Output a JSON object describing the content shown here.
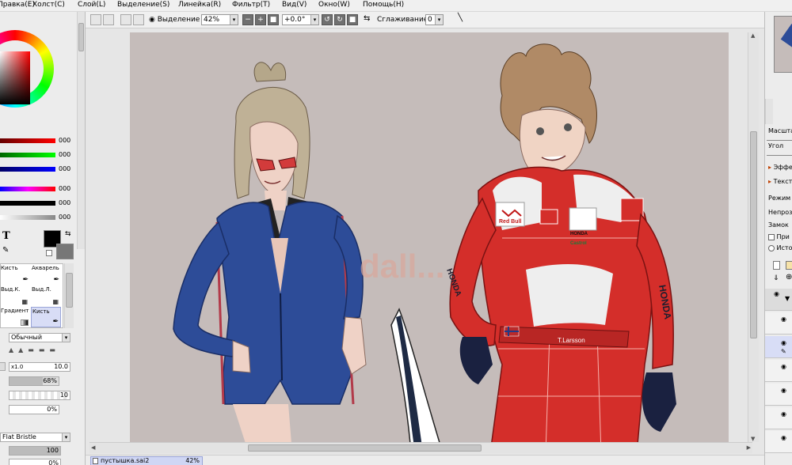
{
  "menu": {
    "items": [
      "Правка(E)",
      "Холст(C)",
      "Слой(L)",
      "Выделение(S)",
      "Линейка(R)",
      "Фильтр(T)",
      "Вид(V)",
      "Окно(W)",
      "Помощь(H)"
    ]
  },
  "color_sliders": {
    "rgb": [
      "000",
      "000",
      "000"
    ],
    "hsv": [
      "000",
      "000",
      "000"
    ]
  },
  "tools": {
    "text_tool": "T",
    "cells": [
      "Кисть",
      "Акварель",
      "Выд.К.",
      "Выд.Л.",
      "Градиент",
      "Кисть"
    ]
  },
  "brush": {
    "blend_mode": "Обычный",
    "size_multiplier": "x1.0",
    "size_value": "10.0",
    "density": "68%",
    "min_size": "10",
    "min_density": "0%",
    "texture": "Flat Bristle",
    "texture_strength": "100",
    "texture_extra": "0%"
  },
  "toolbar": {
    "selection_label": "Выделение",
    "zoom": "42%",
    "minus": "−",
    "plus": "+",
    "rotation": "+0.0°",
    "smoothing_label": "Сглаживание",
    "smoothing_value": "0"
  },
  "canvas": {
    "background": "#c5bcba",
    "watermark": "dall...",
    "redbull_label": "Red Bull",
    "honda_label": "HONDA",
    "castrol_label": "Castrol",
    "name_tag": "T.Larsson",
    "sleeve_text": "HONDA"
  },
  "statusbar": {
    "doc_name": "пустышка.sai2",
    "doc_zoom": "42%"
  },
  "right_panel": {
    "scale_label": "Масшта",
    "angle_label": "Угол",
    "effects_label": "Эффе",
    "texture_label": "Тексту",
    "mode_label": "Режим",
    "opacity_label": "Непроз",
    "lock_label": "Замок",
    "clip_label": "При",
    "source_label": "Исто"
  }
}
